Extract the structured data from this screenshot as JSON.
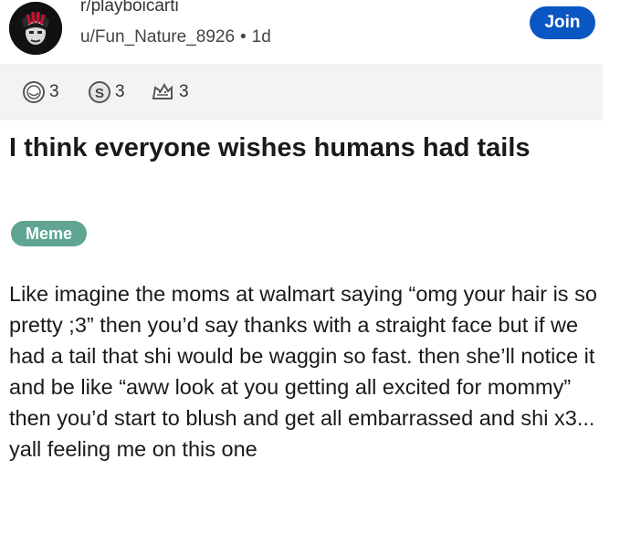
{
  "post_header": {
    "subreddit": "r/playboicarti",
    "username": "u/Fun_Nature_8926",
    "separator": "•",
    "age": "1d",
    "join_label": "Join"
  },
  "awards": [
    {
      "icon": "helpful-award-icon",
      "count": "3"
    },
    {
      "icon": "silver-award-icon",
      "count": "3"
    },
    {
      "icon": "wholesome-award-icon",
      "count": "3"
    }
  ],
  "post": {
    "title": "I think everyone wishes humans had tails",
    "flair": "Meme",
    "body": "Like imagine the moms at walmart saying “omg your hair is so pretty ;3” then you’d say thanks with a straight face but if we had a tail that shi would be waggin so fast. then she’ll notice it and be like “aww look at you getting all excited for mommy” then you’d start to blush and get all embarrassed and shi x3... yall feeling me on this one"
  },
  "colors": {
    "join_button": "#0a56c2",
    "flair_background": "#5fa592",
    "awards_bar_background": "#f3f3f3"
  }
}
